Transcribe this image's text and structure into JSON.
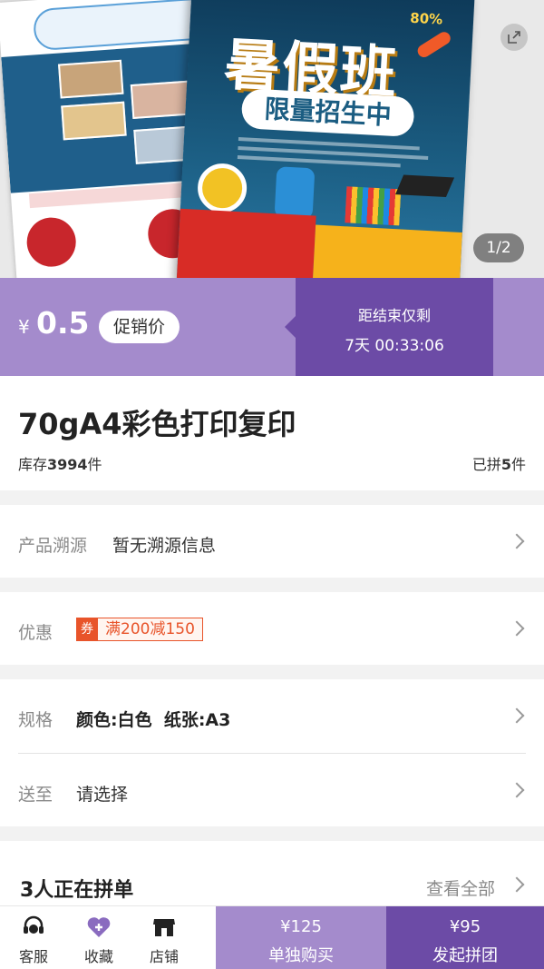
{
  "hero": {
    "pager": "1/2",
    "flyer_title": "暑假班",
    "flyer_subtitle": "限量招生中",
    "flyer_percent": "80%"
  },
  "price": {
    "currency": "¥",
    "value": "0.5",
    "promo_label": "促销价",
    "countdown_label": "距结束仅剩",
    "countdown_time": "7天 00:33:06"
  },
  "product": {
    "title": "70gA4彩色打印复印",
    "stock_prefix": "库存",
    "stock_count": "3994",
    "stock_suffix": "件",
    "grouped_prefix": "已拼",
    "grouped_count": "5",
    "grouped_suffix": "件"
  },
  "rows": {
    "trace_label": "产品溯源",
    "trace_value": "暂无溯源信息",
    "discount_label": "优惠",
    "coupon_tag": "券",
    "coupon_text": "满200减150",
    "spec_label": "规格",
    "spec_value": "颜色:白色  纸张:A3",
    "ship_label": "送至",
    "ship_value": "请选择"
  },
  "group": {
    "title": "3人正在拼单",
    "see_all": "查看全部"
  },
  "bottom": {
    "service_label": "客服",
    "favorite_label": "收藏",
    "store_label": "店铺",
    "alone_price": "¥125",
    "alone_label": "单独购买",
    "group_price": "¥95",
    "group_label": "发起拼团"
  },
  "colors": {
    "accent_light": "#a48bcc",
    "accent_dark": "#6c4ba6",
    "coupon": "#e8542a"
  }
}
